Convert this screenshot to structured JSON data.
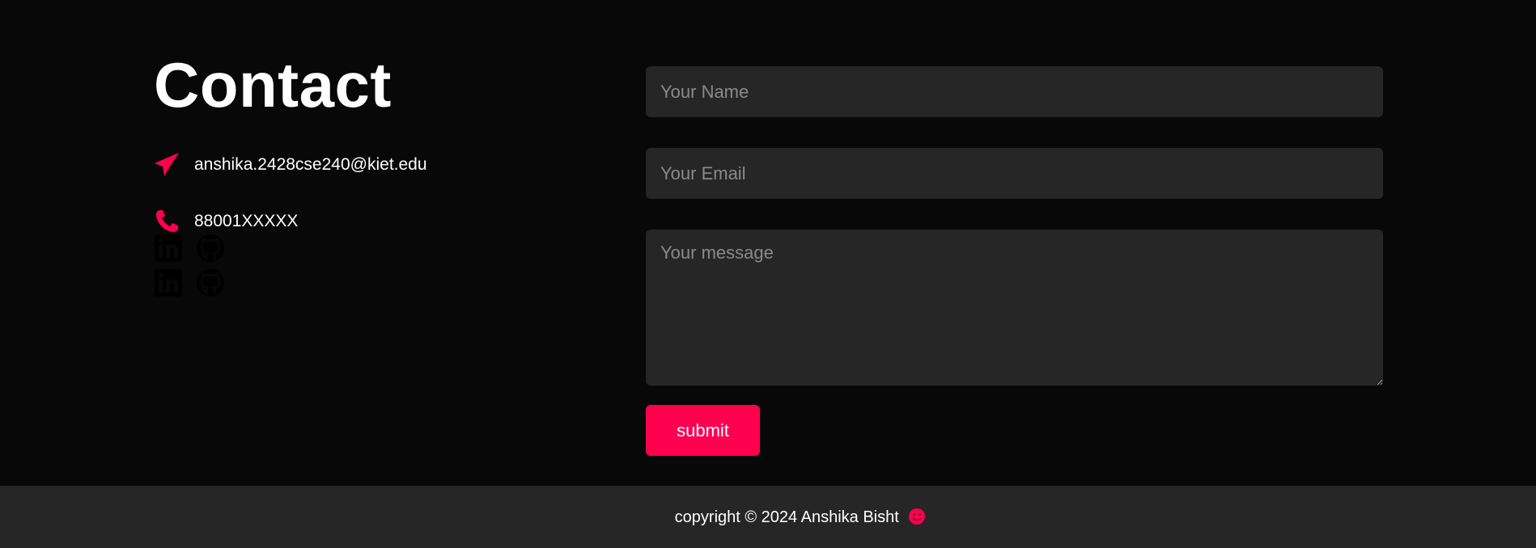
{
  "contact": {
    "title": "Contact",
    "email": "anshika.2428cse240@kiet.edu",
    "phone": "88001XXXXX",
    "email_icon": "paper-plane-icon",
    "phone_icon": "phone-icon",
    "social_icons": [
      "linkedin-icon",
      "github-icon"
    ]
  },
  "form": {
    "name_placeholder": "Your Name",
    "email_placeholder": "Your Email",
    "message_placeholder": "Your message",
    "submit_label": "submit"
  },
  "footer": {
    "copyright": "copyright © 2024 Anshika Bisht",
    "emoji_icon": "smiley-icon"
  },
  "colors": {
    "accent": "#ff004f",
    "background": "#080808",
    "surface": "#262626",
    "text": "#ffffff",
    "placeholder": "#8a8a8a"
  }
}
